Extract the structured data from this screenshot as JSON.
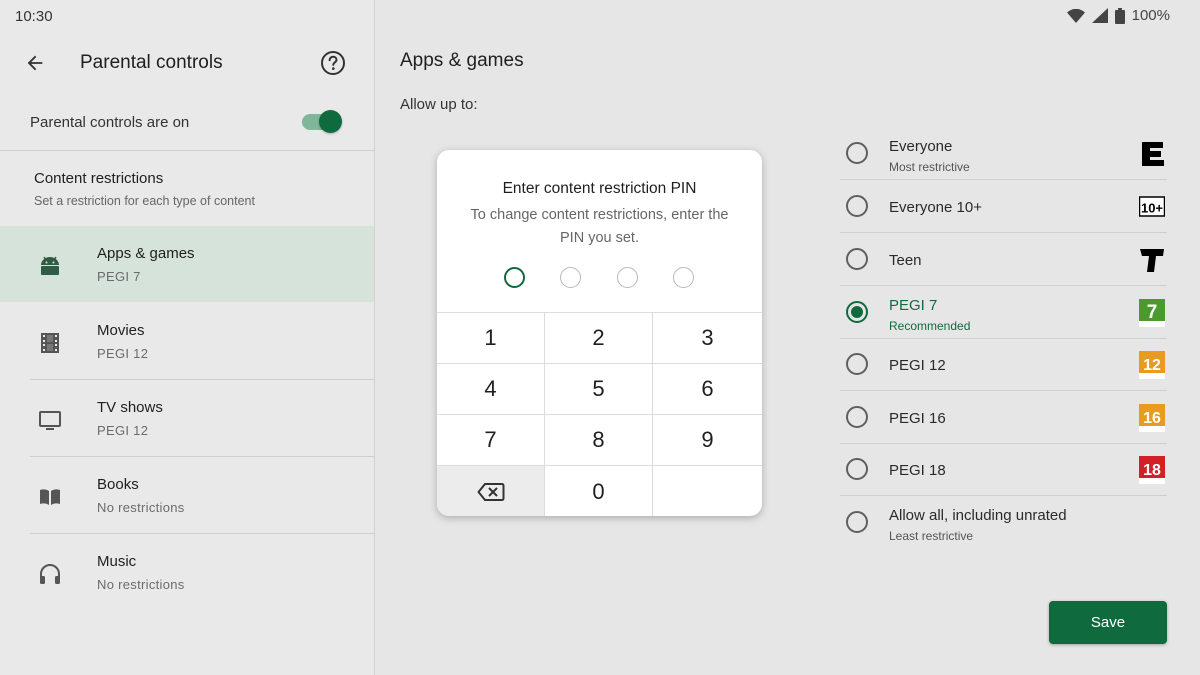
{
  "status": {
    "time": "10:30",
    "battery": "100%"
  },
  "left": {
    "title": "Parental controls",
    "toggle_label": "Parental controls are on",
    "toggle_on": true,
    "section_title": "Content restrictions",
    "section_subtitle": "Set a restriction for each type of content",
    "categories": [
      {
        "name": "Apps & games",
        "value": "PEGI 7",
        "icon": "android-icon",
        "selected": true
      },
      {
        "name": "Movies",
        "value": "PEGI 12",
        "icon": "film-icon",
        "selected": false
      },
      {
        "name": "TV shows",
        "value": "PEGI 12",
        "icon": "tv-icon",
        "selected": false
      },
      {
        "name": "Books",
        "value": "No restrictions",
        "icon": "book-icon",
        "selected": false
      },
      {
        "name": "Music",
        "value": "No restrictions",
        "icon": "headphones-icon",
        "selected": false
      }
    ]
  },
  "right": {
    "title": "Apps & games",
    "allow_label": "Allow up to:",
    "ratings": [
      {
        "name": "Everyone",
        "sub": "Most restrictive",
        "badge": "E",
        "selected": false
      },
      {
        "name": "Everyone 10+",
        "sub": "",
        "badge": "10+",
        "selected": false
      },
      {
        "name": "Teen",
        "sub": "",
        "badge": "T",
        "selected": false
      },
      {
        "name": "PEGI 7",
        "sub": "Recommended",
        "badge": "7",
        "selected": true
      },
      {
        "name": "PEGI 12",
        "sub": "",
        "badge": "12",
        "selected": false
      },
      {
        "name": "PEGI 16",
        "sub": "",
        "badge": "16",
        "selected": false
      },
      {
        "name": "PEGI 18",
        "sub": "",
        "badge": "18",
        "selected": false
      },
      {
        "name": "Allow all, including unrated",
        "sub": "Least restrictive",
        "badge": "",
        "selected": false
      }
    ],
    "save_label": "Save"
  },
  "pin_dialog": {
    "title": "Enter content restriction PIN",
    "description": "To change content restrictions, enter the PIN you set.",
    "digits_entered": 0,
    "digit_count": 4,
    "keys": [
      "1",
      "2",
      "3",
      "4",
      "5",
      "6",
      "7",
      "8",
      "9",
      "",
      "0",
      ""
    ]
  },
  "colors": {
    "accent": "#0f6b3e",
    "selected_row": "#d6e3db",
    "pegi_green": "#4a9a2e",
    "pegi_orange": "#e89b1e",
    "pegi_red": "#d32027"
  }
}
